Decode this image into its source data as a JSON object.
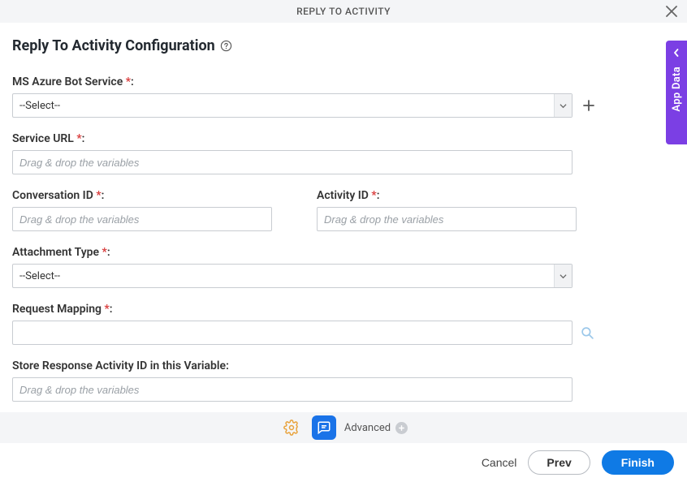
{
  "header": {
    "title": "REPLY TO ACTIVITY"
  },
  "page": {
    "title": "Reply To Activity Configuration"
  },
  "sidebar": {
    "label": "App Data"
  },
  "fields": {
    "azure_bot": {
      "label": "MS Azure Bot Service ",
      "select_value": "--Select--"
    },
    "service_url": {
      "label": "Service URL ",
      "placeholder": "Drag & drop the variables"
    },
    "conversation_id": {
      "label": "Conversation ID ",
      "placeholder": "Drag & drop the variables"
    },
    "activity_id": {
      "label": "Activity ID ",
      "placeholder": "Drag & drop the variables"
    },
    "attachment_type": {
      "label": "Attachment Type ",
      "select_value": "--Select--"
    },
    "request_mapping": {
      "label": "Request Mapping "
    },
    "store_response": {
      "label": "Store Response Activity ID in this Variable:",
      "placeholder": "Drag & drop the variables"
    }
  },
  "toolbar": {
    "advanced_label": "Advanced"
  },
  "footer": {
    "cancel": "Cancel",
    "prev": "Prev",
    "finish": "Finish"
  },
  "colon": ":",
  "asterisk": "*"
}
